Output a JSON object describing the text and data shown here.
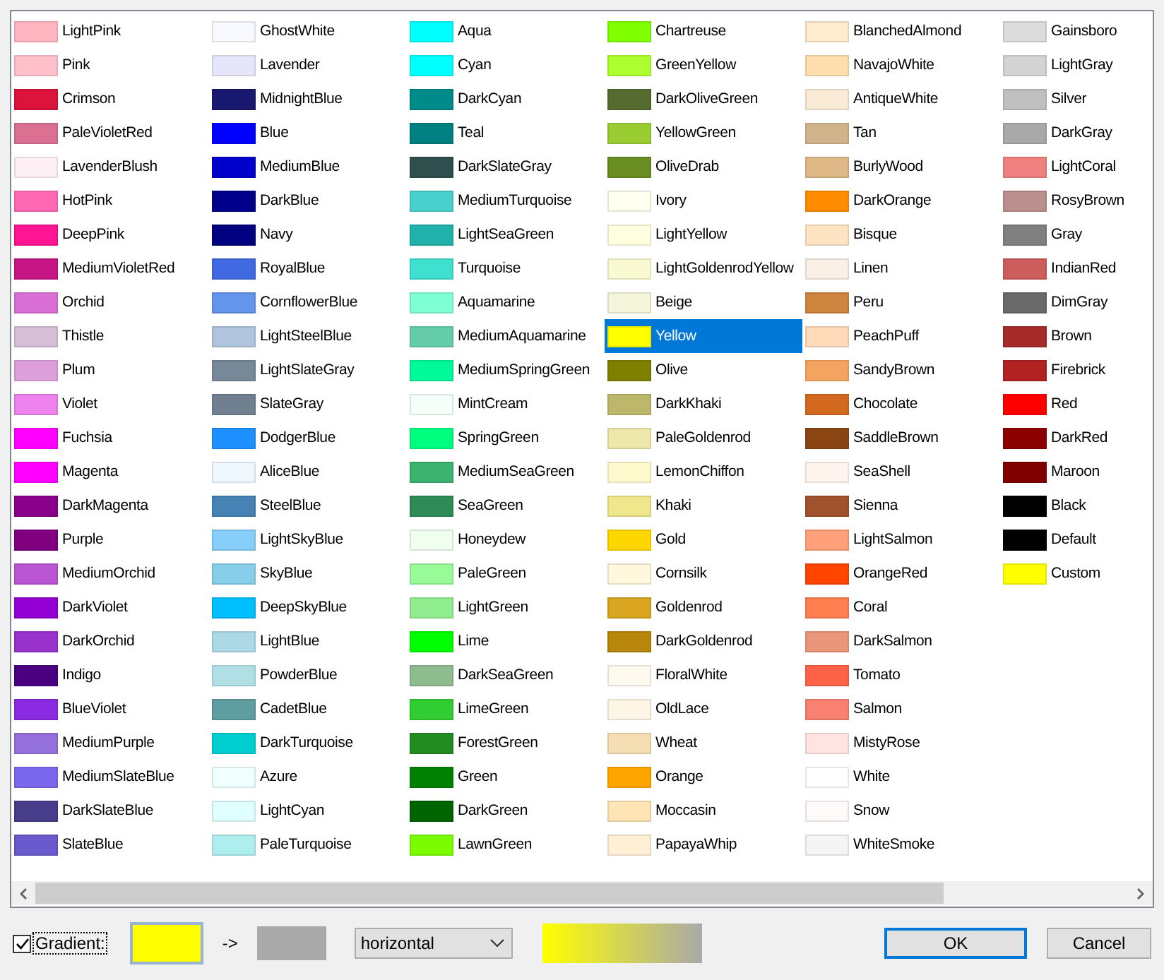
{
  "colors": [
    {
      "name": "LightPink",
      "color": "#ffb6c1",
      "selected": false
    },
    {
      "name": "Pink",
      "color": "#ffc0cb",
      "selected": false
    },
    {
      "name": "Crimson",
      "color": "#dc143c",
      "selected": false
    },
    {
      "name": "PaleVioletRed",
      "color": "#db7093",
      "selected": false
    },
    {
      "name": "LavenderBlush",
      "color": "#fff0f5",
      "selected": false
    },
    {
      "name": "HotPink",
      "color": "#ff69b4",
      "selected": false
    },
    {
      "name": "DeepPink",
      "color": "#ff1493",
      "selected": false
    },
    {
      "name": "MediumVioletRed",
      "color": "#c71585",
      "selected": false
    },
    {
      "name": "Orchid",
      "color": "#da70d6",
      "selected": false
    },
    {
      "name": "Thistle",
      "color": "#d8bfd8",
      "selected": false
    },
    {
      "name": "Plum",
      "color": "#dda0dd",
      "selected": false
    },
    {
      "name": "Violet",
      "color": "#ee82ee",
      "selected": false
    },
    {
      "name": "Fuchsia",
      "color": "#ff00ff",
      "selected": false
    },
    {
      "name": "Magenta",
      "color": "#ff00ff",
      "selected": false
    },
    {
      "name": "DarkMagenta",
      "color": "#8b008b",
      "selected": false
    },
    {
      "name": "Purple",
      "color": "#800080",
      "selected": false
    },
    {
      "name": "MediumOrchid",
      "color": "#ba55d3",
      "selected": false
    },
    {
      "name": "DarkViolet",
      "color": "#9400d3",
      "selected": false
    },
    {
      "name": "DarkOrchid",
      "color": "#9932cc",
      "selected": false
    },
    {
      "name": "Indigo",
      "color": "#4b0082",
      "selected": false
    },
    {
      "name": "BlueViolet",
      "color": "#8a2be2",
      "selected": false
    },
    {
      "name": "MediumPurple",
      "color": "#9370db",
      "selected": false
    },
    {
      "name": "MediumSlateBlue",
      "color": "#7b68ee",
      "selected": false
    },
    {
      "name": "DarkSlateBlue",
      "color": "#483d8b",
      "selected": false
    },
    {
      "name": "SlateBlue",
      "color": "#6a5acd",
      "selected": false
    },
    {
      "name": "GhostWhite",
      "color": "#f8f8ff",
      "selected": false
    },
    {
      "name": "Lavender",
      "color": "#e6e6fa",
      "selected": false
    },
    {
      "name": "MidnightBlue",
      "color": "#191970",
      "selected": false
    },
    {
      "name": "Blue",
      "color": "#0000ff",
      "selected": false
    },
    {
      "name": "MediumBlue",
      "color": "#0000cd",
      "selected": false
    },
    {
      "name": "DarkBlue",
      "color": "#00008b",
      "selected": false
    },
    {
      "name": "Navy",
      "color": "#000080",
      "selected": false
    },
    {
      "name": "RoyalBlue",
      "color": "#4169e1",
      "selected": false
    },
    {
      "name": "CornflowerBlue",
      "color": "#6495ed",
      "selected": false
    },
    {
      "name": "LightSteelBlue",
      "color": "#b0c4de",
      "selected": false
    },
    {
      "name": "LightSlateGray",
      "color": "#778899",
      "selected": false
    },
    {
      "name": "SlateGray",
      "color": "#708090",
      "selected": false
    },
    {
      "name": "DodgerBlue",
      "color": "#1e90ff",
      "selected": false
    },
    {
      "name": "AliceBlue",
      "color": "#f0f8ff",
      "selected": false
    },
    {
      "name": "SteelBlue",
      "color": "#4682b4",
      "selected": false
    },
    {
      "name": "LightSkyBlue",
      "color": "#87cefa",
      "selected": false
    },
    {
      "name": "SkyBlue",
      "color": "#87ceeb",
      "selected": false
    },
    {
      "name": "DeepSkyBlue",
      "color": "#00bfff",
      "selected": false
    },
    {
      "name": "LightBlue",
      "color": "#add8e6",
      "selected": false
    },
    {
      "name": "PowderBlue",
      "color": "#b0e0e6",
      "selected": false
    },
    {
      "name": "CadetBlue",
      "color": "#5f9ea0",
      "selected": false
    },
    {
      "name": "DarkTurquoise",
      "color": "#00ced1",
      "selected": false
    },
    {
      "name": "Azure",
      "color": "#f0ffff",
      "selected": false
    },
    {
      "name": "LightCyan",
      "color": "#e0ffff",
      "selected": false
    },
    {
      "name": "PaleTurquoise",
      "color": "#afeeee",
      "selected": false
    },
    {
      "name": "Aqua",
      "color": "#00ffff",
      "selected": false
    },
    {
      "name": "Cyan",
      "color": "#00ffff",
      "selected": false
    },
    {
      "name": "DarkCyan",
      "color": "#008b8b",
      "selected": false
    },
    {
      "name": "Teal",
      "color": "#008080",
      "selected": false
    },
    {
      "name": "DarkSlateGray",
      "color": "#2f4f4f",
      "selected": false
    },
    {
      "name": "MediumTurquoise",
      "color": "#48d1cc",
      "selected": false
    },
    {
      "name": "LightSeaGreen",
      "color": "#20b2aa",
      "selected": false
    },
    {
      "name": "Turquoise",
      "color": "#40e0d0",
      "selected": false
    },
    {
      "name": "Aquamarine",
      "color": "#7fffd4",
      "selected": false
    },
    {
      "name": "MediumAquamarine",
      "color": "#66cdaa",
      "selected": false
    },
    {
      "name": "MediumSpringGreen",
      "color": "#00fa9a",
      "selected": false
    },
    {
      "name": "MintCream",
      "color": "#f5fffa",
      "selected": false
    },
    {
      "name": "SpringGreen",
      "color": "#00ff7f",
      "selected": false
    },
    {
      "name": "MediumSeaGreen",
      "color": "#3cb371",
      "selected": false
    },
    {
      "name": "SeaGreen",
      "color": "#2e8b57",
      "selected": false
    },
    {
      "name": "Honeydew",
      "color": "#f0fff0",
      "selected": false
    },
    {
      "name": "PaleGreen",
      "color": "#98fb98",
      "selected": false
    },
    {
      "name": "LightGreen",
      "color": "#90ee90",
      "selected": false
    },
    {
      "name": "Lime",
      "color": "#00ff00",
      "selected": false
    },
    {
      "name": "DarkSeaGreen",
      "color": "#8fbc8f",
      "selected": false
    },
    {
      "name": "LimeGreen",
      "color": "#32cd32",
      "selected": false
    },
    {
      "name": "ForestGreen",
      "color": "#228b22",
      "selected": false
    },
    {
      "name": "Green",
      "color": "#008000",
      "selected": false
    },
    {
      "name": "DarkGreen",
      "color": "#006400",
      "selected": false
    },
    {
      "name": "LawnGreen",
      "color": "#7cfc00",
      "selected": false
    },
    {
      "name": "Chartreuse",
      "color": "#7fff00",
      "selected": false
    },
    {
      "name": "GreenYellow",
      "color": "#adff2f",
      "selected": false
    },
    {
      "name": "DarkOliveGreen",
      "color": "#556b2f",
      "selected": false
    },
    {
      "name": "YellowGreen",
      "color": "#9acd32",
      "selected": false
    },
    {
      "name": "OliveDrab",
      "color": "#6b8e23",
      "selected": false
    },
    {
      "name": "Ivory",
      "color": "#fffff0",
      "selected": false
    },
    {
      "name": "LightYellow",
      "color": "#ffffe0",
      "selected": false
    },
    {
      "name": "LightGoldenrodYellow",
      "color": "#fafad2",
      "selected": false
    },
    {
      "name": "Beige",
      "color": "#f5f5dc",
      "selected": false
    },
    {
      "name": "Yellow",
      "color": "#ffff00",
      "selected": true
    },
    {
      "name": "Olive",
      "color": "#808000",
      "selected": false
    },
    {
      "name": "DarkKhaki",
      "color": "#bdb76b",
      "selected": false
    },
    {
      "name": "PaleGoldenrod",
      "color": "#eee8aa",
      "selected": false
    },
    {
      "name": "LemonChiffon",
      "color": "#fffacd",
      "selected": false
    },
    {
      "name": "Khaki",
      "color": "#f0e68c",
      "selected": false
    },
    {
      "name": "Gold",
      "color": "#ffd700",
      "selected": false
    },
    {
      "name": "Cornsilk",
      "color": "#fff8dc",
      "selected": false
    },
    {
      "name": "Goldenrod",
      "color": "#daa520",
      "selected": false
    },
    {
      "name": "DarkGoldenrod",
      "color": "#b8860b",
      "selected": false
    },
    {
      "name": "FloralWhite",
      "color": "#fffaf0",
      "selected": false
    },
    {
      "name": "OldLace",
      "color": "#fdf5e6",
      "selected": false
    },
    {
      "name": "Wheat",
      "color": "#f5deb3",
      "selected": false
    },
    {
      "name": "Orange",
      "color": "#ffa500",
      "selected": false
    },
    {
      "name": "Moccasin",
      "color": "#ffe4b5",
      "selected": false
    },
    {
      "name": "PapayaWhip",
      "color": "#ffefd5",
      "selected": false
    },
    {
      "name": "BlanchedAlmond",
      "color": "#ffebcd",
      "selected": false
    },
    {
      "name": "NavajoWhite",
      "color": "#ffdead",
      "selected": false
    },
    {
      "name": "AntiqueWhite",
      "color": "#faebd7",
      "selected": false
    },
    {
      "name": "Tan",
      "color": "#d2b48c",
      "selected": false
    },
    {
      "name": "BurlyWood",
      "color": "#deb887",
      "selected": false
    },
    {
      "name": "DarkOrange",
      "color": "#ff8c00",
      "selected": false
    },
    {
      "name": "Bisque",
      "color": "#ffe4c4",
      "selected": false
    },
    {
      "name": "Linen",
      "color": "#faf0e6",
      "selected": false
    },
    {
      "name": "Peru",
      "color": "#cd853f",
      "selected": false
    },
    {
      "name": "PeachPuff",
      "color": "#ffdab9",
      "selected": false
    },
    {
      "name": "SandyBrown",
      "color": "#f4a460",
      "selected": false
    },
    {
      "name": "Chocolate",
      "color": "#d2691e",
      "selected": false
    },
    {
      "name": "SaddleBrown",
      "color": "#8b4513",
      "selected": false
    },
    {
      "name": "SeaShell",
      "color": "#fff5ee",
      "selected": false
    },
    {
      "name": "Sienna",
      "color": "#a0522d",
      "selected": false
    },
    {
      "name": "LightSalmon",
      "color": "#ffa07a",
      "selected": false
    },
    {
      "name": "OrangeRed",
      "color": "#ff4500",
      "selected": false
    },
    {
      "name": "Coral",
      "color": "#ff7f50",
      "selected": false
    },
    {
      "name": "DarkSalmon",
      "color": "#e9967a",
      "selected": false
    },
    {
      "name": "Tomato",
      "color": "#ff6347",
      "selected": false
    },
    {
      "name": "Salmon",
      "color": "#fa8072",
      "selected": false
    },
    {
      "name": "MistyRose",
      "color": "#ffe4e1",
      "selected": false
    },
    {
      "name": "White",
      "color": "#ffffff",
      "selected": false
    },
    {
      "name": "Snow",
      "color": "#fffafa",
      "selected": false
    },
    {
      "name": "WhiteSmoke",
      "color": "#f5f5f5",
      "selected": false
    },
    {
      "name": "Gainsboro",
      "color": "#dcdcdc",
      "selected": false
    },
    {
      "name": "LightGray",
      "color": "#d3d3d3",
      "selected": false
    },
    {
      "name": "Silver",
      "color": "#c0c0c0",
      "selected": false
    },
    {
      "name": "DarkGray",
      "color": "#a9a9a9",
      "selected": false
    },
    {
      "name": "LightCoral",
      "color": "#f08080",
      "selected": false
    },
    {
      "name": "RosyBrown",
      "color": "#bc8f8f",
      "selected": false
    },
    {
      "name": "Gray",
      "color": "#808080",
      "selected": false
    },
    {
      "name": "IndianRed",
      "color": "#cd5c5c",
      "selected": false
    },
    {
      "name": "DimGray",
      "color": "#696969",
      "selected": false
    },
    {
      "name": "Brown",
      "color": "#a52a2a",
      "selected": false
    },
    {
      "name": "Firebrick",
      "color": "#b22222",
      "selected": false
    },
    {
      "name": "Red",
      "color": "#ff0000",
      "selected": false
    },
    {
      "name": "DarkRed",
      "color": "#8b0000",
      "selected": false
    },
    {
      "name": "Maroon",
      "color": "#800000",
      "selected": false
    },
    {
      "name": "Black",
      "color": "#000000",
      "selected": false
    },
    {
      "name": "Default",
      "color": "#000000",
      "selected": false
    },
    {
      "name": "Custom",
      "color": "#ffff00",
      "selected": false
    }
  ],
  "gradient": {
    "label": "Gradient:",
    "checked": true,
    "stops": [
      {
        "color": "#ffff00"
      },
      {
        "color": "#a9a9a9"
      }
    ],
    "arrow": "->",
    "direction": "horizontal"
  },
  "buttons": [
    {
      "label": "OK",
      "kind": "default"
    },
    {
      "label": "Cancel",
      "kind": "normal"
    }
  ]
}
